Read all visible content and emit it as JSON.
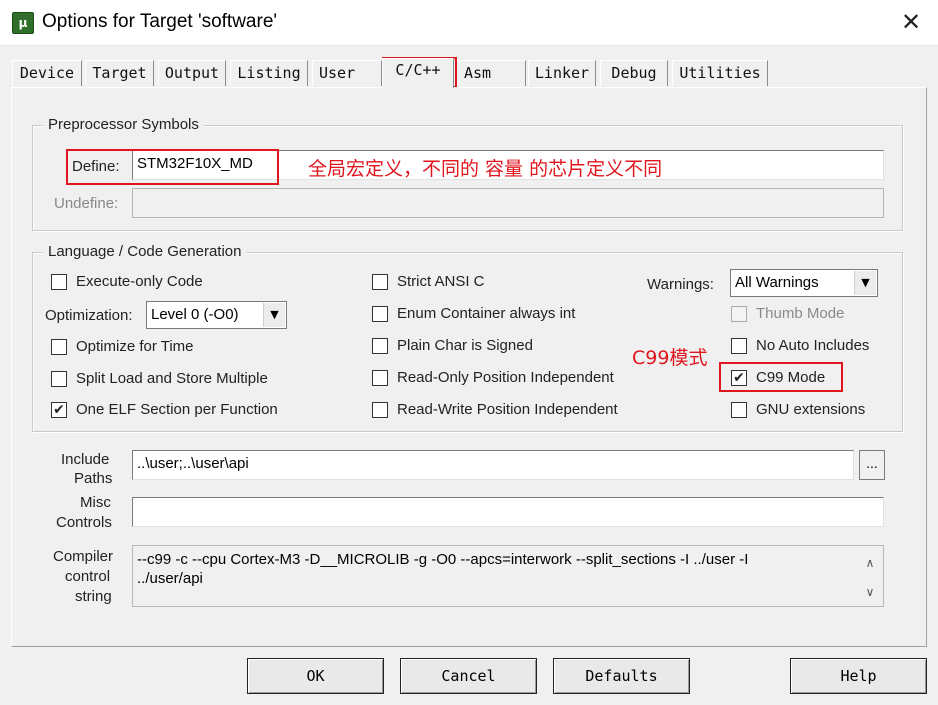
{
  "window": {
    "app_icon_text": "μ",
    "title": "Options for Target 'software'",
    "close_glyph": "✕"
  },
  "tabs": [
    {
      "label": "Device",
      "active": false
    },
    {
      "label": "Target",
      "active": false
    },
    {
      "label": "Output",
      "active": false
    },
    {
      "label": "Listing",
      "active": false
    },
    {
      "label": "User",
      "active": false
    },
    {
      "label": "C/C++",
      "active": true
    },
    {
      "label": "Asm",
      "active": false
    },
    {
      "label": "Linker",
      "active": false
    },
    {
      "label": "Debug",
      "active": false
    },
    {
      "label": "Utilities",
      "active": false
    }
  ],
  "preprocessor": {
    "group_title": "Preprocessor Symbols",
    "define_label": "Define:",
    "define_value": "STM32F10X_MD",
    "undefine_label": "Undefine:",
    "undefine_value": ""
  },
  "language": {
    "group_title": "Language / Code Generation",
    "execute_only": {
      "label": "Execute-only Code",
      "checked": false
    },
    "optimization_label": "Optimization:",
    "optimization_value": "Level 0 (-O0)",
    "optimize_time": {
      "label": "Optimize for Time",
      "checked": false
    },
    "split_load": {
      "label": "Split Load and Store Multiple",
      "checked": false
    },
    "one_elf": {
      "label": "One ELF Section per Function",
      "checked": true
    },
    "strict_ansi": {
      "label": "Strict ANSI C",
      "checked": false
    },
    "enum_container": {
      "label": "Enum Container always int",
      "checked": false
    },
    "plain_char": {
      "label": "Plain Char is Signed",
      "checked": false
    },
    "ro_position": {
      "label": "Read-Only Position Independent",
      "checked": false
    },
    "rw_position": {
      "label": "Read-Write Position Independent",
      "checked": false
    },
    "warnings_label": "Warnings:",
    "warnings_value": "All Warnings",
    "thumb_mode": {
      "label": "Thumb Mode",
      "checked": false,
      "disabled": true
    },
    "no_auto_includes": {
      "label": "No Auto Includes",
      "checked": false
    },
    "c99_mode": {
      "label": "C99 Mode",
      "checked": true
    },
    "gnu_extensions": {
      "label": "GNU extensions",
      "checked": false
    }
  },
  "include_paths": {
    "label_line1": "Include",
    "label_line2": "Paths",
    "value": "..\\user;..\\user\\api",
    "browse_label": "..."
  },
  "misc_controls": {
    "label_line1": "Misc",
    "label_line2": "Controls",
    "value": ""
  },
  "compiler_control": {
    "label_line1": "Compiler",
    "label_line2": "control",
    "label_line3": "string",
    "line1": "--c99 -c --cpu Cortex-M3 -D__MICROLIB -g -O0 --apcs=interwork --split_sections -I ../user -I",
    "line2": "../user/api",
    "scroll_up": "∧",
    "scroll_down": "∨"
  },
  "annotations": {
    "define_note": "全局宏定义，不同的 容量 的芯片定义不同",
    "c99_note": "C99模式",
    "color": "#e0161e"
  },
  "buttons": {
    "ok": "OK",
    "cancel": "Cancel",
    "defaults": "Defaults",
    "help": "Help"
  },
  "check_glyph": "✔",
  "dropdown_glyph": "▼"
}
